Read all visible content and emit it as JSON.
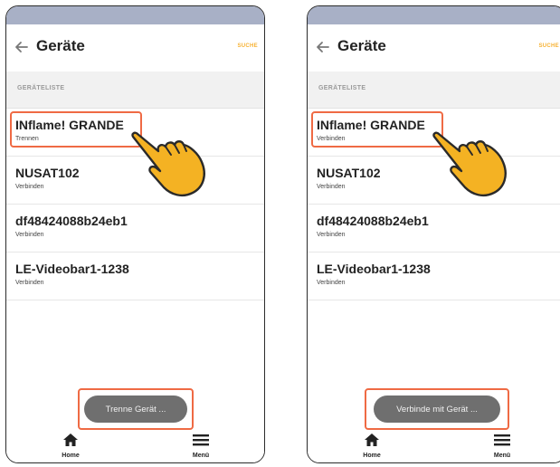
{
  "left": {
    "title": "Geräte",
    "action": "SUCHE",
    "section_header": "GERÄTELISTE",
    "devices": [
      {
        "name": "INflame! GRANDE",
        "status": "Trennen"
      },
      {
        "name": "NUSAT102",
        "status": "Verbinden"
      },
      {
        "name": "df48424088b24eb1",
        "status": "Verbinden"
      },
      {
        "name": "LE-Videobar1-1238",
        "status": "Verbinden"
      }
    ],
    "toast": "Trenne Gerät ...",
    "nav": {
      "home": "Home",
      "menu": "Menü"
    }
  },
  "right": {
    "title": "Geräte",
    "action": "SUCHE",
    "section_header": "GERÄTELISTE",
    "devices": [
      {
        "name": "INflame! GRANDE",
        "status": "Verbinden"
      },
      {
        "name": "NUSAT102",
        "status": "Verbinden"
      },
      {
        "name": "df48424088b24eb1",
        "status": "Verbinden"
      },
      {
        "name": "LE-Videobar1-1238",
        "status": "Verbinden"
      }
    ],
    "toast": "Verbinde mit Gerät ...",
    "nav": {
      "home": "Home",
      "menu": "Menü"
    }
  },
  "colors": {
    "accent": "#f7b233",
    "highlight": "#ef6a44",
    "statusbar": "#a8b0c6",
    "toast": "#6f6f6f"
  }
}
